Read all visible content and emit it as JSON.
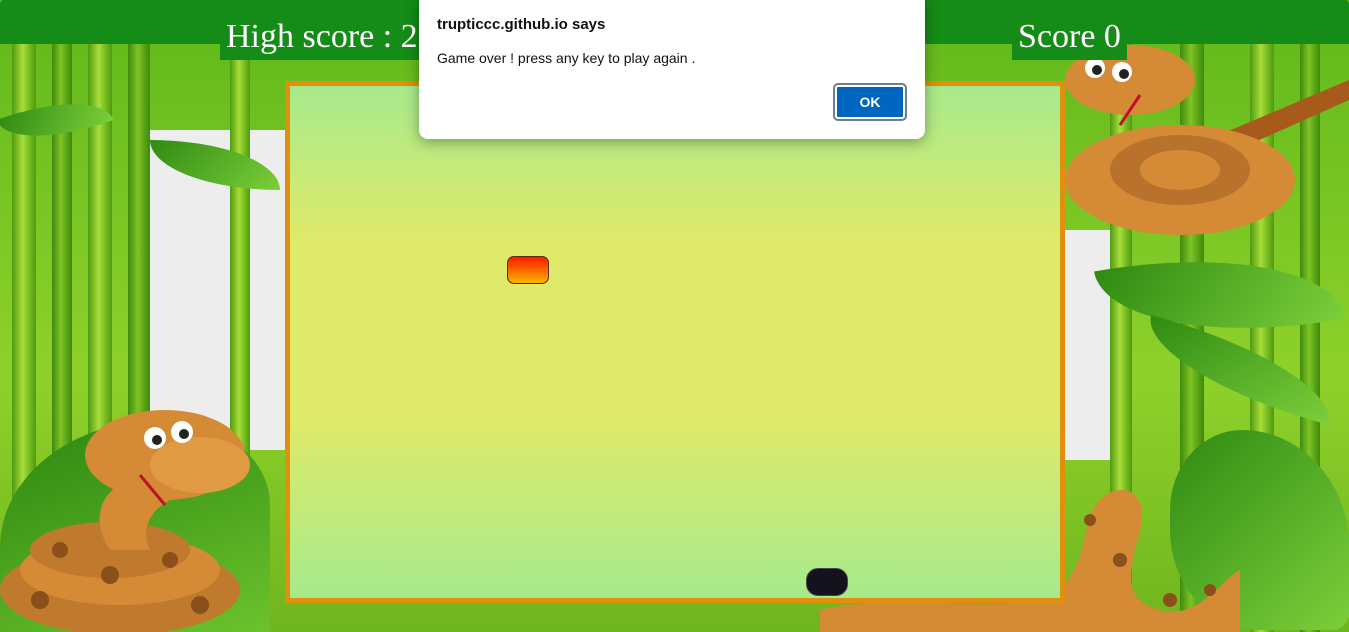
{
  "header": {
    "high_score_label": "High score : 2",
    "score_label": "Score 0"
  },
  "game": {
    "food_icon": "food-block",
    "snake_head_icon": "snake-head-block",
    "colors": {
      "topbar": "#148c17",
      "board_border": "#e0900c",
      "food_top": "#ff1a00",
      "food_bottom": "#f7b500",
      "snake": "#14121d"
    }
  },
  "dialog": {
    "origin": "trupticcc.github.io says",
    "message": "Game over ! press any key to play again .",
    "ok_label": "OK",
    "ok_color": "#0067c0"
  }
}
